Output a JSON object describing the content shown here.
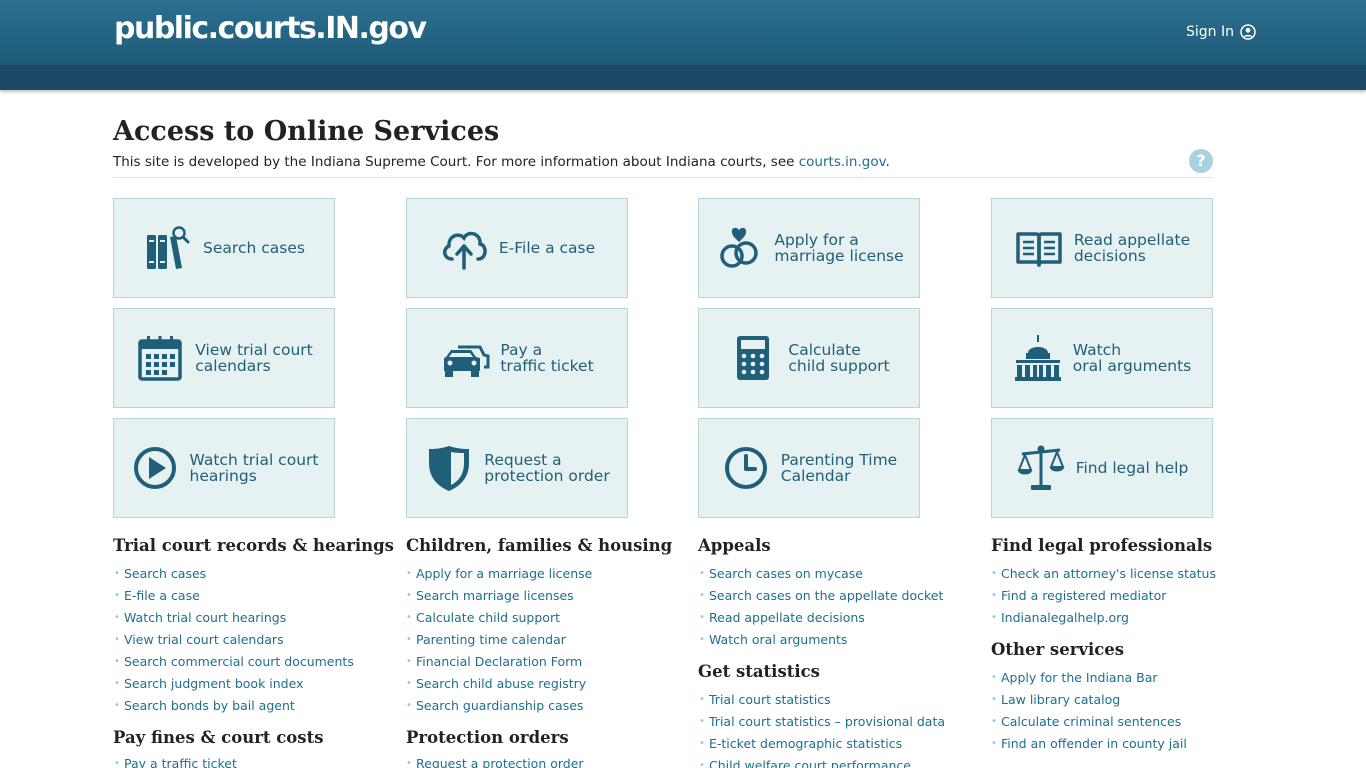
{
  "header": {
    "brand": "public.courts.IN.gov",
    "signin_label": "Sign In"
  },
  "main": {
    "title": "Access to Online Services",
    "intro_text": "This site is developed by the Indiana Supreme Court. For more information about Indiana courts, see ",
    "intro_link": "courts.in.gov",
    "intro_end": ".",
    "help": "?"
  },
  "tiles": [
    {
      "label": "Search cases",
      "icon": "books-search-icon"
    },
    {
      "label": "E-File a case",
      "icon": "cloud-upload-icon"
    },
    {
      "label": "Apply for a\nmarriage license",
      "icon": "rings-heart-icon"
    },
    {
      "label": "Read appellate\ndecisions",
      "icon": "open-book-icon"
    },
    {
      "label": "View trial court\ncalendars",
      "icon": "calendar-icon"
    },
    {
      "label": "Pay a\ntraffic ticket",
      "icon": "cars-icon"
    },
    {
      "label": "Calculate\nchild support",
      "icon": "calculator-icon"
    },
    {
      "label": "Watch\noral arguments",
      "icon": "capitol-icon"
    },
    {
      "label": "Watch trial court\nhearings",
      "icon": "play-circle-icon"
    },
    {
      "label": "Request a\nprotection order",
      "icon": "shield-icon"
    },
    {
      "label": "Parenting Time\nCalendar",
      "icon": "clock-icon"
    },
    {
      "label": "Find legal help",
      "icon": "scales-icon"
    }
  ],
  "sections": {
    "trial": {
      "title": "Trial court records & hearings",
      "links": [
        "Search cases",
        "E-file a case",
        "Watch trial court hearings",
        "View trial court calendars",
        "Search commercial court documents",
        "Search judgment book index",
        "Search bonds by bail agent"
      ]
    },
    "fines": {
      "title": "Pay fines & court costs",
      "links": [
        "Pay a traffic ticket"
      ]
    },
    "children": {
      "title": "Children, families & housing",
      "links": [
        "Apply for a marriage license",
        "Search marriage licenses",
        "Calculate child support",
        "Parenting time calendar",
        "Financial Declaration Form",
        "Search child abuse registry",
        "Search guardianship cases"
      ]
    },
    "protection": {
      "title": "Protection orders",
      "links": [
        "Request a protection order"
      ]
    },
    "appeals": {
      "title": "Appeals",
      "links": [
        "Search cases on mycase",
        "Search cases on the appellate docket",
        "Read appellate decisions",
        "Watch oral arguments"
      ]
    },
    "statistics": {
      "title": "Get statistics",
      "links": [
        "Trial court statistics",
        "Trial court statistics – provisional data",
        "E-ticket demographic statistics",
        "Child welfare court performance"
      ]
    },
    "professionals": {
      "title": "Find legal professionals",
      "links": [
        "Check an attorney's license status",
        "Find a registered mediator",
        "Indianalegalhelp.org"
      ]
    },
    "other": {
      "title": "Other services",
      "links": [
        "Apply for the Indiana Bar",
        "Law library catalog",
        "Calculate criminal sentences",
        "Find an offender in county jail"
      ]
    }
  },
  "colors": {
    "header": "#246685",
    "subbar": "#1c4a64",
    "tile_bg": "#e6f1f1",
    "tile_border": "#b9d4da",
    "icon": "#1f5f7a",
    "link": "#1f6e8e"
  }
}
